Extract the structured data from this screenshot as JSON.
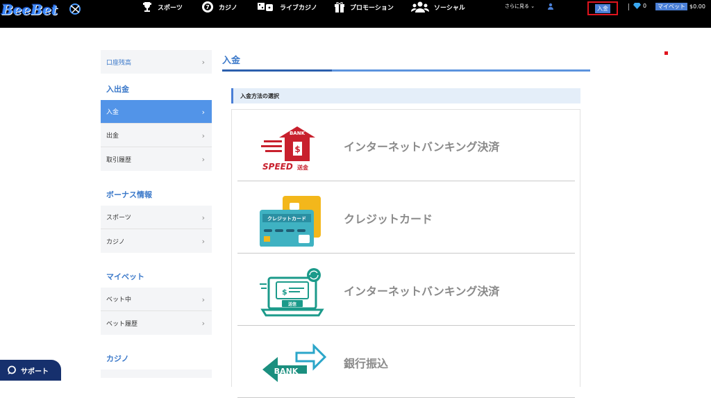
{
  "header": {
    "logo": "BeeBet",
    "nav": [
      {
        "label": "スポーツ",
        "icon": "trophy-icon"
      },
      {
        "label": "カジノ",
        "icon": "casino-chip-icon"
      },
      {
        "label": "ライブカジノ",
        "icon": "live-casino-icon"
      },
      {
        "label": "プロモーション",
        "icon": "gift-icon"
      },
      {
        "label": "ソーシャル",
        "icon": "users-icon"
      }
    ],
    "more_label": "さらに見る",
    "deposit_label": "入金",
    "gem_count": "0",
    "mybet_label": "マイベット",
    "balance": "$0.00"
  },
  "sidebar": {
    "top_item": "口座残高",
    "sections": [
      {
        "title": "入出金",
        "items": [
          "入金",
          "出金",
          "取引履歴"
        ]
      },
      {
        "title": "ボーナス情報",
        "items": [
          "スポーツ",
          "カジノ"
        ]
      },
      {
        "title": "マイベット",
        "items": [
          "ベット中",
          "ベット履歴"
        ]
      },
      {
        "title": "カジノ",
        "items": []
      }
    ],
    "active_item": "入金"
  },
  "main": {
    "title": "入金",
    "section_title": "入金方法の選択",
    "methods": [
      {
        "label": "インターネットバンキング決済",
        "icon": "speed-bank-icon",
        "icon_text": [
          "BANK",
          "SPEED",
          "送金"
        ]
      },
      {
        "label": "クレジットカード",
        "icon": "credit-card-icon",
        "icon_text": [
          "クレジットカード"
        ]
      },
      {
        "label": "インターネットバンキング決済",
        "icon": "laptop-transfer-icon",
        "icon_text": [
          "送信"
        ]
      },
      {
        "label": "銀行振込",
        "icon": "bank-transfer-icon",
        "icon_text": [
          "BANK"
        ]
      }
    ]
  },
  "support": {
    "label": "サポート"
  },
  "colors": {
    "accent": "#4a7fd6",
    "header_bg": "#000000",
    "active": "#5294e8",
    "highlight_border": "#e0141e",
    "support_bg": "#16306d"
  }
}
